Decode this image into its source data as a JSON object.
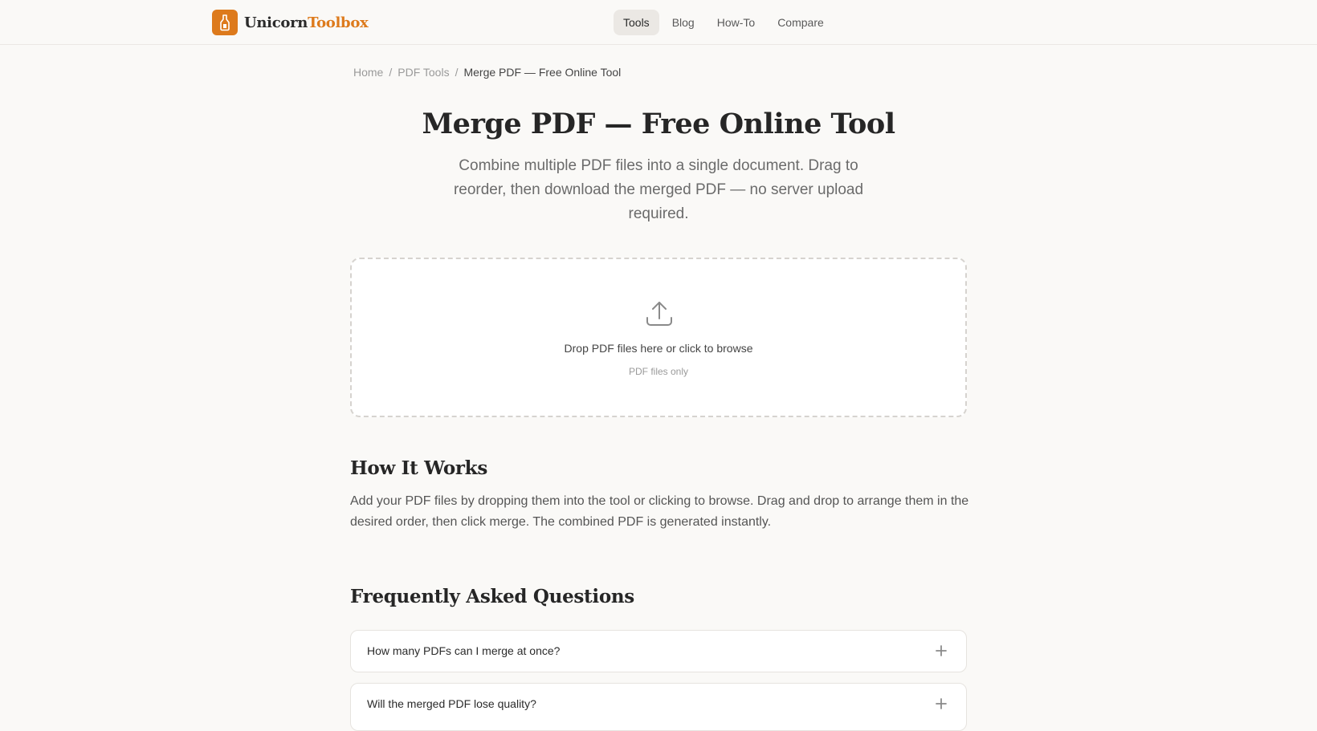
{
  "brand": {
    "name_part1": "Unicorn",
    "name_part2": "Toolbox",
    "accent_color": "#dd7a1c",
    "logo_icon": "bottle-icon"
  },
  "nav": {
    "items": [
      {
        "label": "Tools",
        "active": true
      },
      {
        "label": "Blog",
        "active": false
      },
      {
        "label": "How-To",
        "active": false
      },
      {
        "label": "Compare",
        "active": false
      }
    ]
  },
  "breadcrumb": {
    "items": [
      "Home",
      "PDF Tools"
    ],
    "separator": "/",
    "current": "Merge PDF — Free Online Tool"
  },
  "page": {
    "title": "Merge PDF — Free Online Tool",
    "subtitle": "Combine multiple PDF files into a single document. Drag to reorder, then download the merged PDF — no server upload required."
  },
  "dropzone": {
    "icon": "upload-icon",
    "main_text": "Drop PDF files here or click to browse",
    "sub_text": "PDF files only"
  },
  "how_it_works": {
    "title": "How It Works",
    "text": "Add your PDF files by dropping them into the tool or clicking to browse. Drag and drop to arrange them in the desired order, then click merge. The combined PDF is generated instantly."
  },
  "faq": {
    "title": "Frequently Asked Questions",
    "items": [
      {
        "question": "How many PDFs can I merge at once?"
      },
      {
        "question": "Will the merged PDF lose quality?"
      }
    ]
  }
}
